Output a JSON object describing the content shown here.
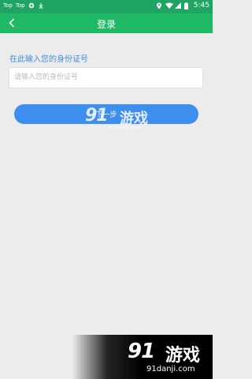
{
  "status_bar": {
    "left_texts": [
      "Top",
      "Top"
    ],
    "time": "5:45",
    "icons": [
      "android-icon",
      "download-icon",
      "location-icon",
      "wifi-icon",
      "signal-icon",
      "battery-icon"
    ]
  },
  "title_bar": {
    "title": "登录",
    "back_icon": "chevron-left-icon"
  },
  "form": {
    "label": "在此输入您的身份证号",
    "input_placeholder": "请输入您的身份证号",
    "input_value": ""
  },
  "next_button": {
    "label": "下一步"
  },
  "watermarks": {
    "logo": "91",
    "name": "游戏",
    "url": "91danji.com"
  },
  "colors": {
    "status_bar": "#1fa463",
    "title_bar": "#1fb864",
    "label": "#3d8ee0",
    "button": "#3e8ef0",
    "background": "#ececec"
  }
}
